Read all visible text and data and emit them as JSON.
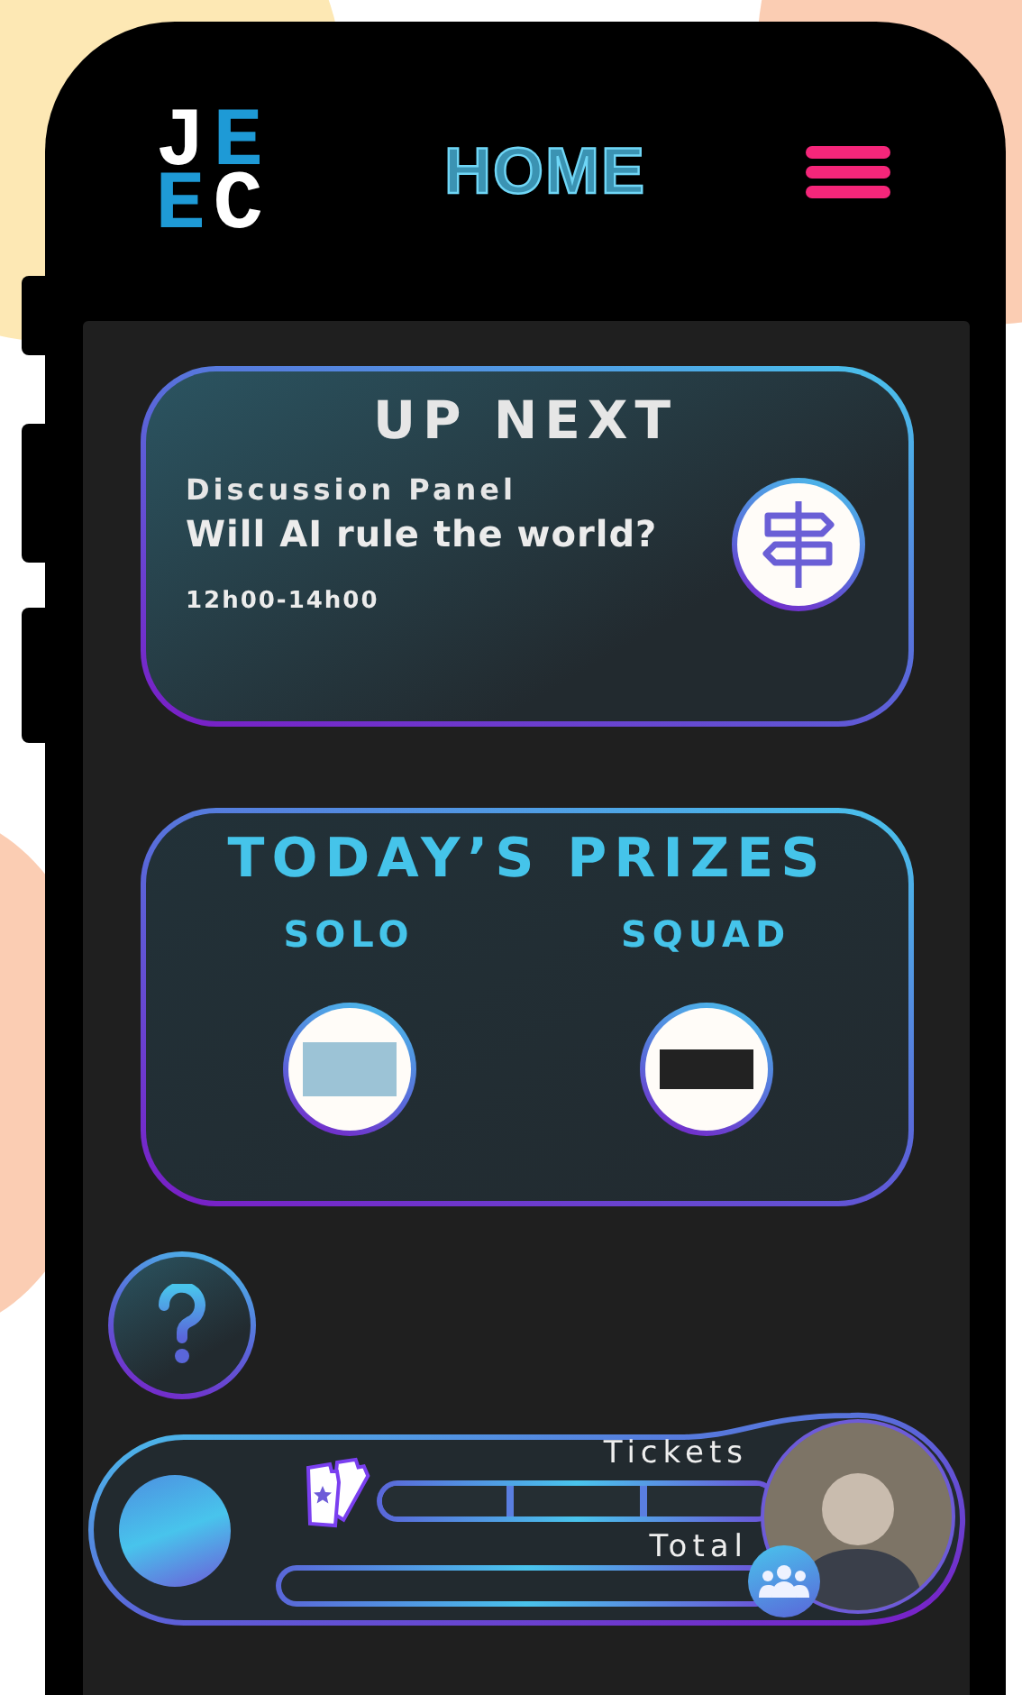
{
  "header": {
    "logo_letters": [
      {
        "letter": "J",
        "color": "#ffffff"
      },
      {
        "letter": "E",
        "color": "#1e9ad6"
      },
      {
        "letter": "E",
        "color": "#1e9ad6"
      },
      {
        "letter": "C",
        "color": "#ffffff"
      }
    ],
    "title": "HOME"
  },
  "up_next": {
    "heading": "UP NEXT",
    "category": "Discussion Panel",
    "title": "Will AI rule the world?",
    "time": "12h00-14h00"
  },
  "prizes": {
    "heading": "TODAY’S PRIZES",
    "tiers": [
      {
        "label": "SOLO"
      },
      {
        "label": "SQUAD"
      }
    ]
  },
  "player": {
    "tickets_label": "Tickets",
    "tickets_segments": [
      {
        "level": 0
      },
      {
        "level": 0
      },
      {
        "level": 0
      }
    ],
    "total_label": "Total",
    "total": {
      "level": 0
    }
  }
}
